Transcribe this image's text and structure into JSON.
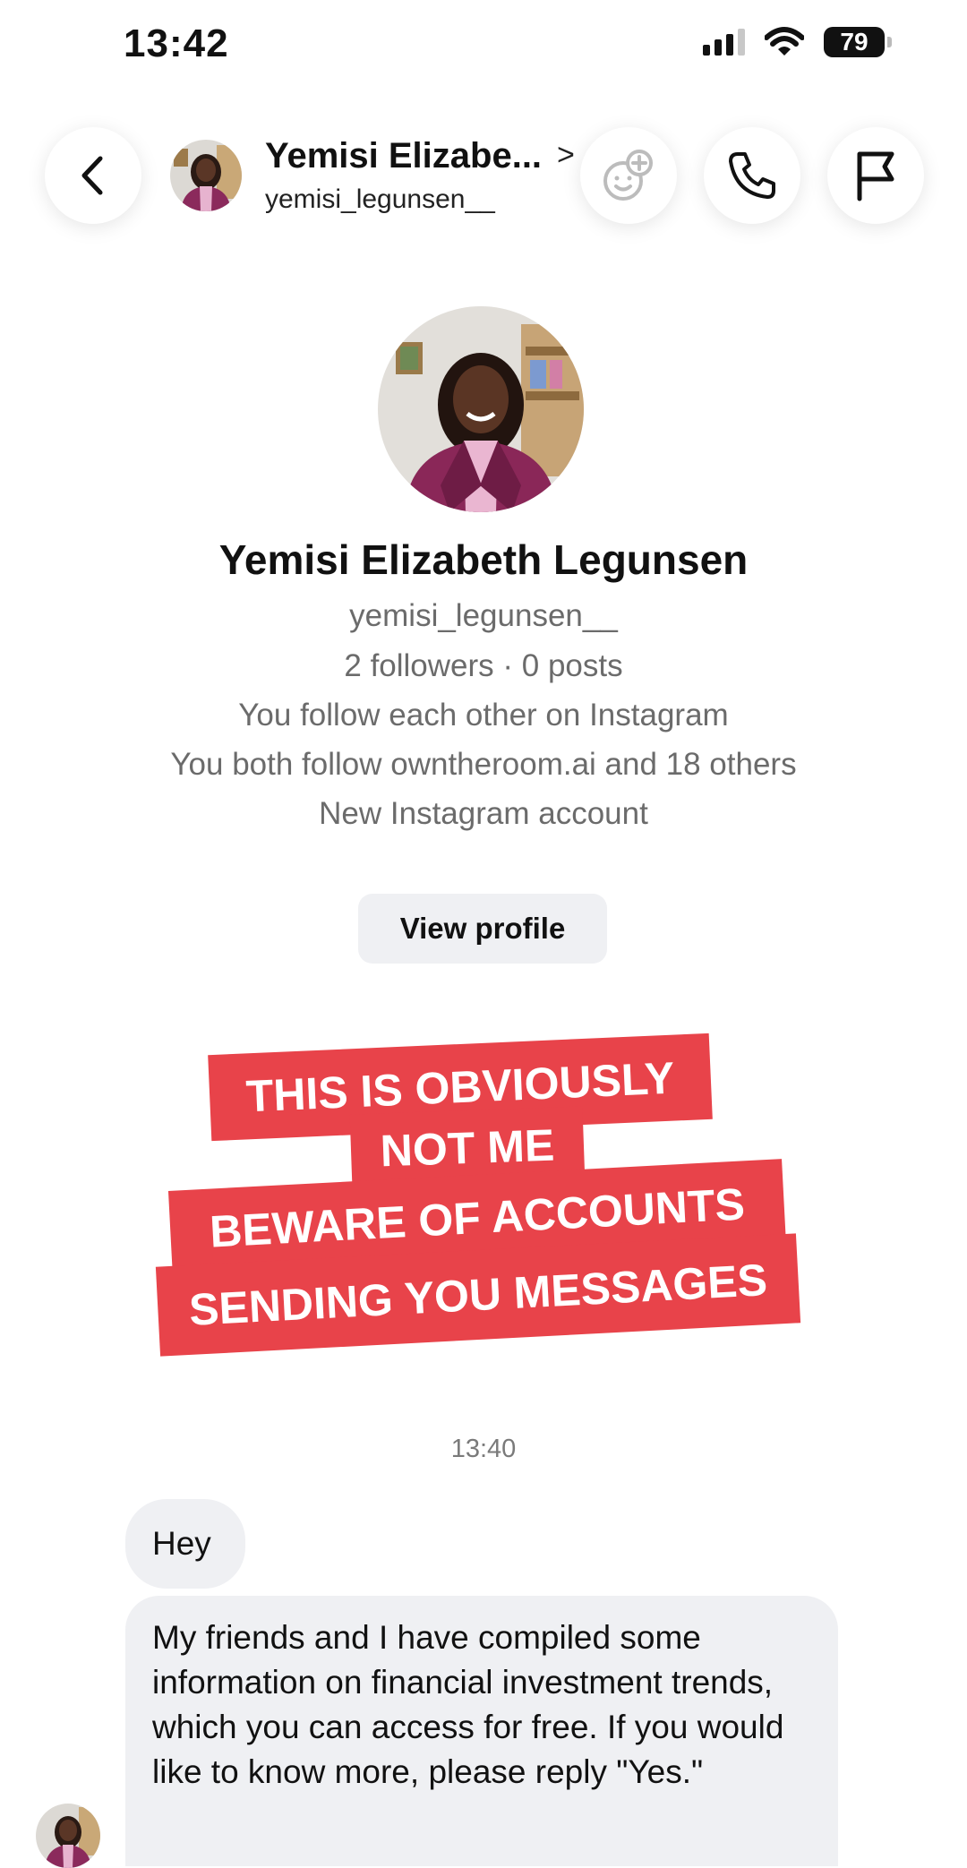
{
  "status_bar": {
    "time": "13:42",
    "battery": "79"
  },
  "header": {
    "name": "Yemisi Elizabe...",
    "chevron": ">",
    "username": "yemisi_legunsen__",
    "icons": [
      "back-icon",
      "effects-icon",
      "phone-icon",
      "flag-icon"
    ]
  },
  "profile": {
    "name": "Yemisi Elizabeth Legunsen",
    "username": "yemisi_legunsen__",
    "stats": "2 followers · 0 posts",
    "mutual": "You follow each other on Instagram",
    "mutual_follows": "You both follow owntheroom.ai and 18 others",
    "new_account": "New Instagram account",
    "view_button": "View profile"
  },
  "overlay": {
    "line1": "THIS IS OBVIOUSLY",
    "line2": "NOT ME",
    "line3": "BEWARE OF ACCOUNTS",
    "line4": "SENDING YOU MESSAGES",
    "color": "#e8434a"
  },
  "chat": {
    "timestamp": "13:40",
    "messages": [
      {
        "text": "Hey"
      },
      {
        "text": "My friends and I have compiled some information on financial investment trends, which you can access for free. If you would like to know more, please reply \"Yes.\""
      }
    ]
  }
}
